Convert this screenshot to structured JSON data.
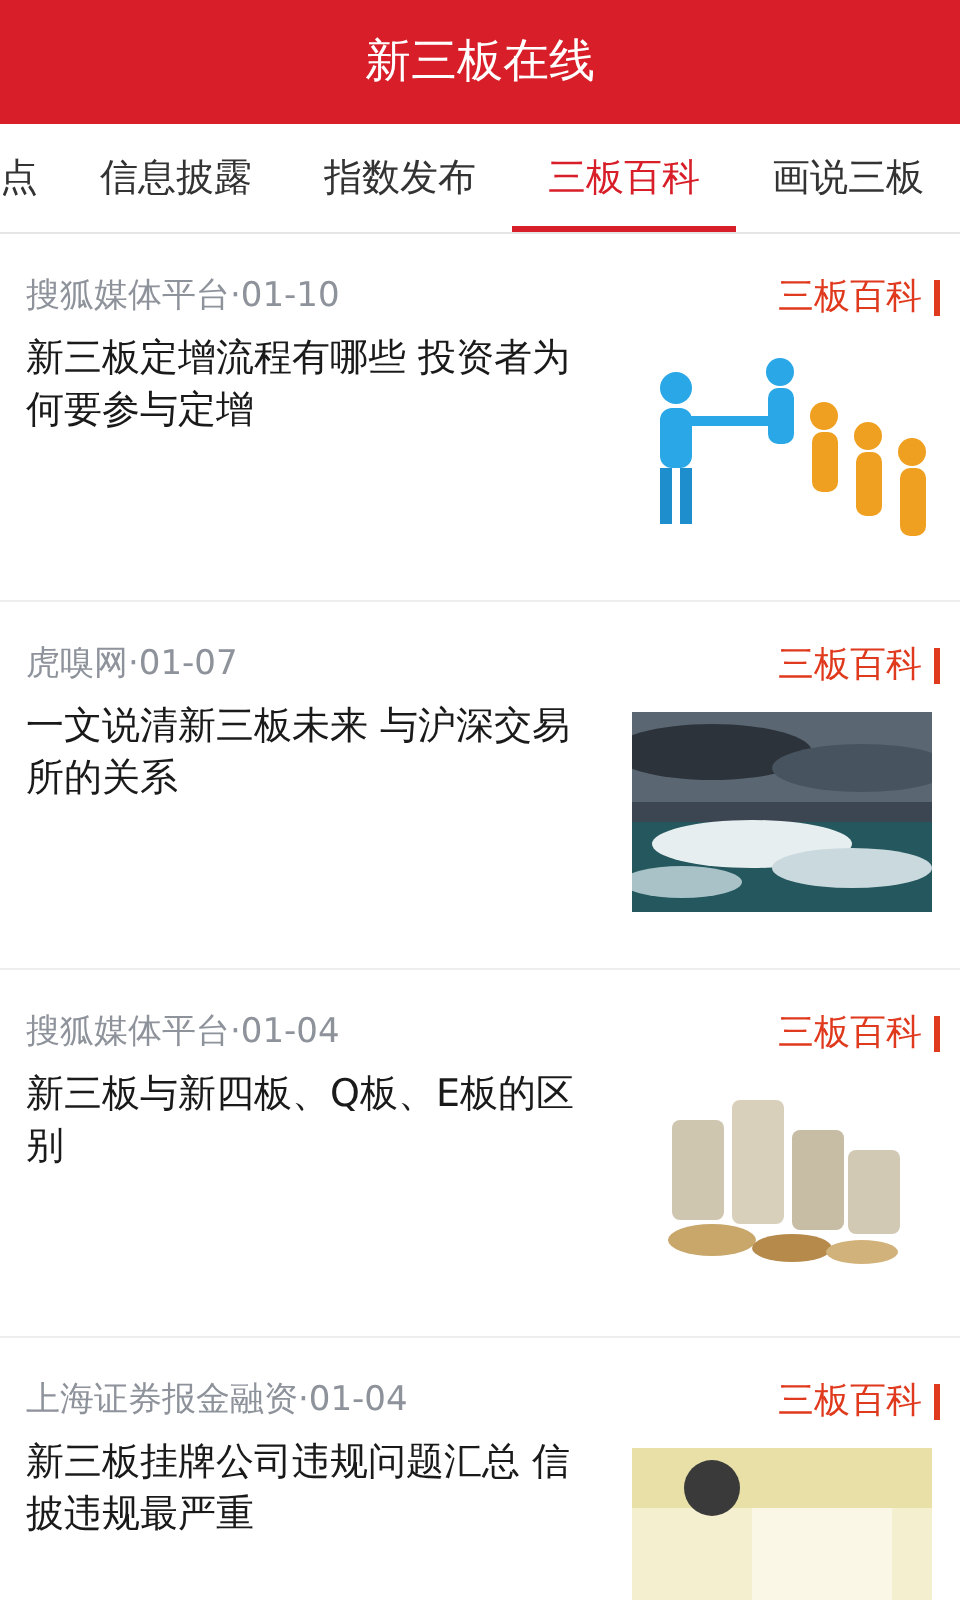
{
  "header": {
    "title": "新三板在线"
  },
  "tabs": [
    {
      "label": "点",
      "selected": false
    },
    {
      "label": "信息披露",
      "selected": false
    },
    {
      "label": "指数发布",
      "selected": false
    },
    {
      "label": "三板百科",
      "selected": true
    },
    {
      "label": "画说三板",
      "selected": false
    }
  ],
  "articles": [
    {
      "source": "搜狐媒体平台·01-10",
      "tag": "三板百科",
      "title": "新三板定增流程有哪些 投资者为何要参与定增"
    },
    {
      "source": "虎嗅网·01-07",
      "tag": "三板百科",
      "title": "一文说清新三板未来 与沪深交易所的关系"
    },
    {
      "source": "搜狐媒体平台·01-04",
      "tag": "三板百科",
      "title": "新三板与新四板、Q板、E板的区别"
    },
    {
      "source": "上海证券报金融资·01-04",
      "tag": "三板百科",
      "title": "新三板挂牌公司违规问题汇总 信披违规最严重"
    }
  ]
}
